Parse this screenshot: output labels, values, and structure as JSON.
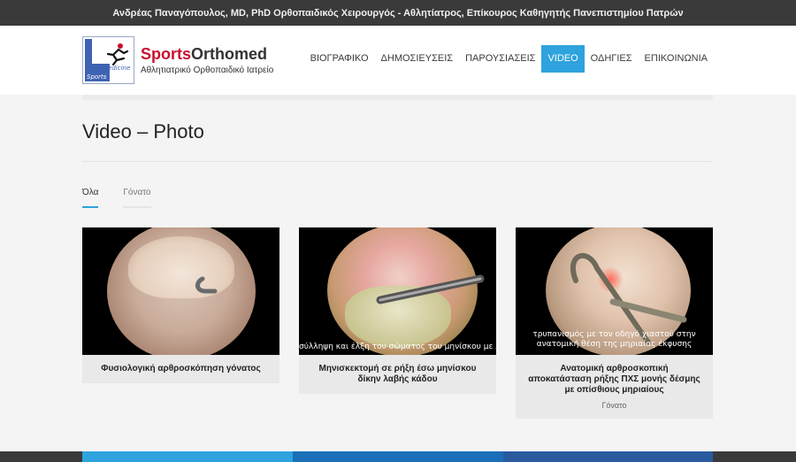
{
  "topbar": {
    "text": "Ανδρέας Παναγόπουλος, MD, PhD Ορθοπαιδικός Χειρουργός - Αθλητίατρος, Επίκουρος Καθηγητής Πανεπιστημίου Πατρών"
  },
  "logo": {
    "brand_part1": "Sports",
    "brand_part2": "Orthomed",
    "tagline": "Αθλητιατρικό Ορθοπαιδικό Ιατρείο",
    "badge_medicine": "Medicine",
    "badge_sports": "Sports"
  },
  "nav": {
    "items": [
      {
        "label": "ΒΙΟΓΡΑΦΙΚΟ"
      },
      {
        "label": "ΔΗΜΟΣΙΕΥΣΕΙΣ"
      },
      {
        "label": "ΠΑΡΟΥΣΙΑΣΕΙΣ"
      },
      {
        "label": "VIDEO"
      },
      {
        "label": "ΟΔΗΓΙΕΣ"
      },
      {
        "label": "ΕΠΙΚΟΙΝΩΝΙΑ"
      }
    ],
    "active_index": 3
  },
  "page": {
    "title": "Video – Photo"
  },
  "filters": [
    {
      "label": "Όλα"
    },
    {
      "label": "Γόνατο"
    }
  ],
  "cards": [
    {
      "title": "Φυσιολογική αρθροσκόπηση γόνατος",
      "caption": "",
      "category": ""
    },
    {
      "title": "Μηνισκεκτομή σε ρήξη έσω μηνίσκου δίκην λαβής κάδου",
      "caption": "σύλληψη και έλξη του σώματος του μηνίσκου με λαβίδα",
      "category": ""
    },
    {
      "title": "Ανατομική αρθροσκοπική αποκατάσταση ρήξης ΠΧΣ μονής δέσμης με οπίσθιους μηριαίους",
      "caption": "τρυπανισμός με τον οδηγό χιαστού στην ανατομική θέση της μηριαίας έκφυσης",
      "category": "Γόνατο"
    }
  ],
  "colors": {
    "accent": "#2ea3dd",
    "brand_red": "#c8102e",
    "topbar_bg": "#3a3a3a"
  }
}
